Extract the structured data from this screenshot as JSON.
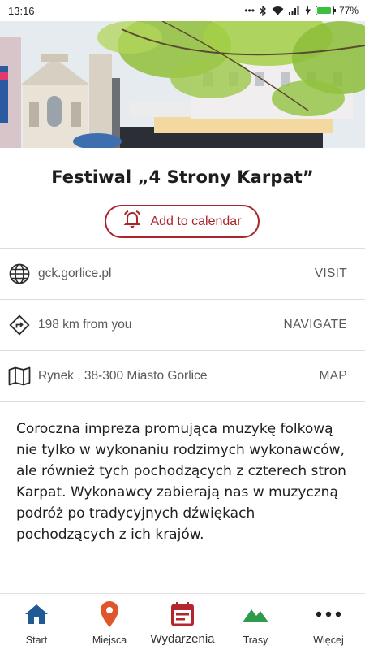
{
  "status_bar": {
    "time": "13:16",
    "battery": "77%"
  },
  "hero": {
    "image": "festival-photo"
  },
  "event": {
    "title": "Festiwal „4 Strony Karpat”",
    "calendar_button": "Add to calendar"
  },
  "info": {
    "website": {
      "text": "gck.gorlice.pl",
      "action": "VISIT",
      "icon": "globe-icon"
    },
    "distance": {
      "text": "198 km from you",
      "action": "NAVIGATE",
      "icon": "directions-icon"
    },
    "address": {
      "text": "Rynek , 38-300 Miasto Gorlice",
      "action": "MAP",
      "icon": "map-icon"
    }
  },
  "description": "Coroczna impreza promująca muzykę folkową nie tylko w wykonaniu rodzimych wykonawców, ale również tych pochodzących z czterech stron Karpat. Wykonawcy zabierają nas w muzyczną podróż po tradycyjnych dźwiękach pochodzących z ich krajów.",
  "nav": {
    "items": [
      {
        "label": "Start",
        "icon": "home-icon",
        "color": "#1f5a96"
      },
      {
        "label": "Miejsca",
        "icon": "location-pin-icon",
        "color": "#e0552a"
      },
      {
        "label": "Wydarzenia",
        "icon": "calendar-icon",
        "color": "#b3262e"
      },
      {
        "label": "Trasy",
        "icon": "mountain-icon",
        "color": "#2e9b4a"
      },
      {
        "label": "Więcej",
        "icon": "more-dots-icon",
        "color": "#222222"
      }
    ]
  },
  "colors": {
    "accent": "#a8262b"
  }
}
